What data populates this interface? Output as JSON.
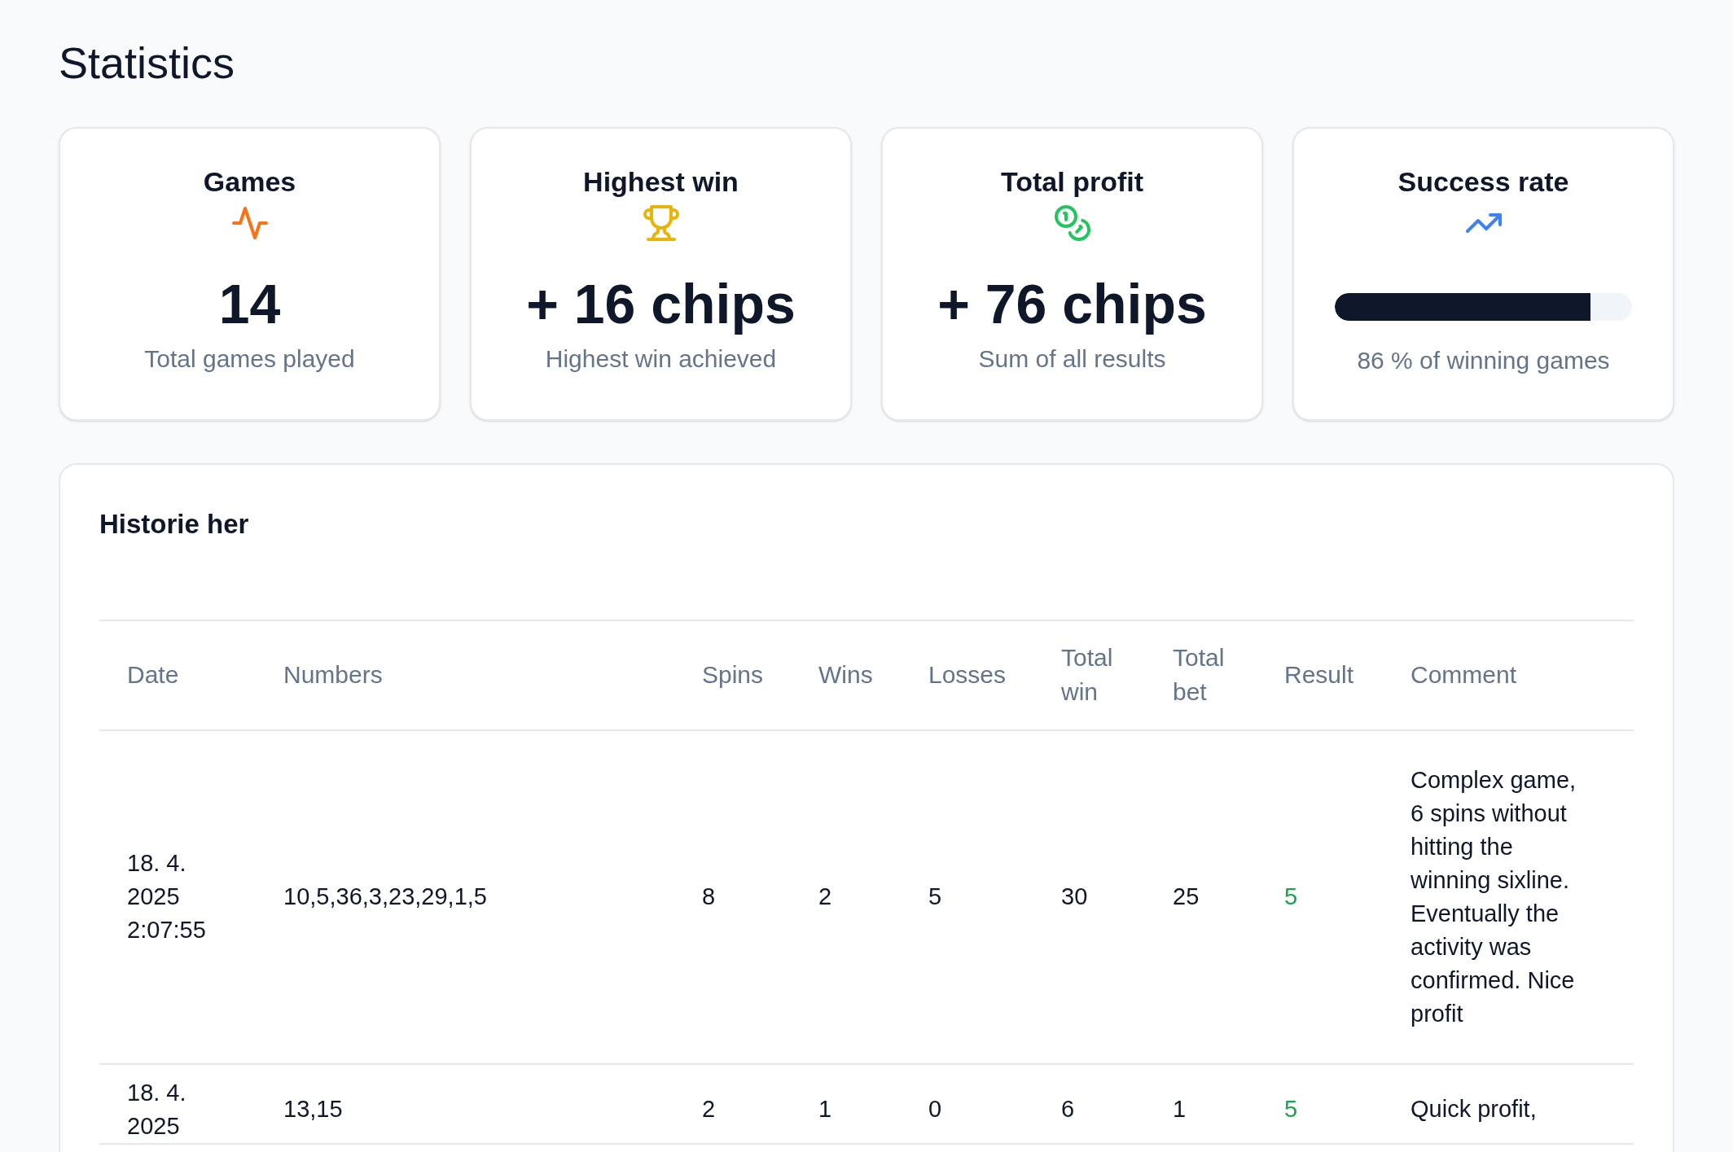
{
  "page": {
    "title": "Statistics"
  },
  "cards": [
    {
      "kind": "value",
      "title": "Games",
      "value": "14",
      "caption": "Total games played"
    },
    {
      "kind": "value",
      "title": "Highest win",
      "value": "+ 16 chips",
      "caption": "Highest win achieved"
    },
    {
      "kind": "value",
      "title": "Total profit",
      "value": "+ 76 chips",
      "caption": "Sum of all results"
    },
    {
      "kind": "progress",
      "title": "Success rate",
      "level": 0.86,
      "caption": "86 % of winning games"
    }
  ],
  "history": {
    "title": "Historie her",
    "columns": [
      "Date",
      "Numbers",
      "Spins",
      "Wins",
      "Losses",
      "Total win",
      "Total bet",
      "Result",
      "Comment"
    ],
    "rows": [
      {
        "cells": [
          "18. 4. 2025 2:07:55",
          "10,5,36,3,23,29,1,5",
          "8",
          "2",
          "5",
          "30",
          "25",
          "5",
          "Complex game, 6 spins without hitting the winning sixline. Eventually the activity was confirmed. Nice profit"
        ]
      },
      {
        "cells": [
          "18. 4. 2025",
          "13,15",
          "2",
          "1",
          "0",
          "6",
          "1",
          "5",
          "Quick profit,"
        ]
      }
    ]
  }
}
